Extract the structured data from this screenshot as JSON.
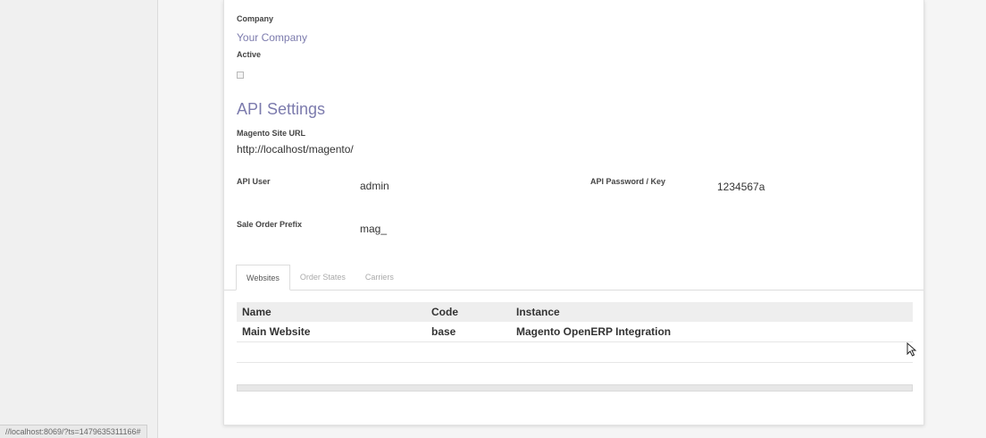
{
  "form": {
    "company_label": "Company",
    "company_value": "Your Company",
    "active_label": "Active",
    "active_checked": false
  },
  "api_settings": {
    "title": "API Settings",
    "site_url_label": "Magento Site URL",
    "site_url_value": "http://localhost/magento/",
    "api_user_label": "API User",
    "api_user_value": "admin",
    "api_password_label": "API Password / Key",
    "api_password_value": "1234567a",
    "sale_prefix_label": "Sale Order Prefix",
    "sale_prefix_value": "mag_"
  },
  "tabs": [
    {
      "label": "Websites",
      "active": true
    },
    {
      "label": "Order States",
      "active": false
    },
    {
      "label": "Carriers",
      "active": false
    }
  ],
  "websites_table": {
    "columns": [
      "Name",
      "Code",
      "Instance"
    ],
    "rows": [
      {
        "name": "Main Website",
        "code": "base",
        "instance": "Magento OpenERP Integration"
      }
    ]
  },
  "status_bar": {
    "url": "//localhost:8069/?ts=1479635311166#"
  },
  "colors": {
    "accent": "#7c7bad"
  },
  "icons": {
    "mouse_cursor": "mouse-pointer-icon"
  }
}
